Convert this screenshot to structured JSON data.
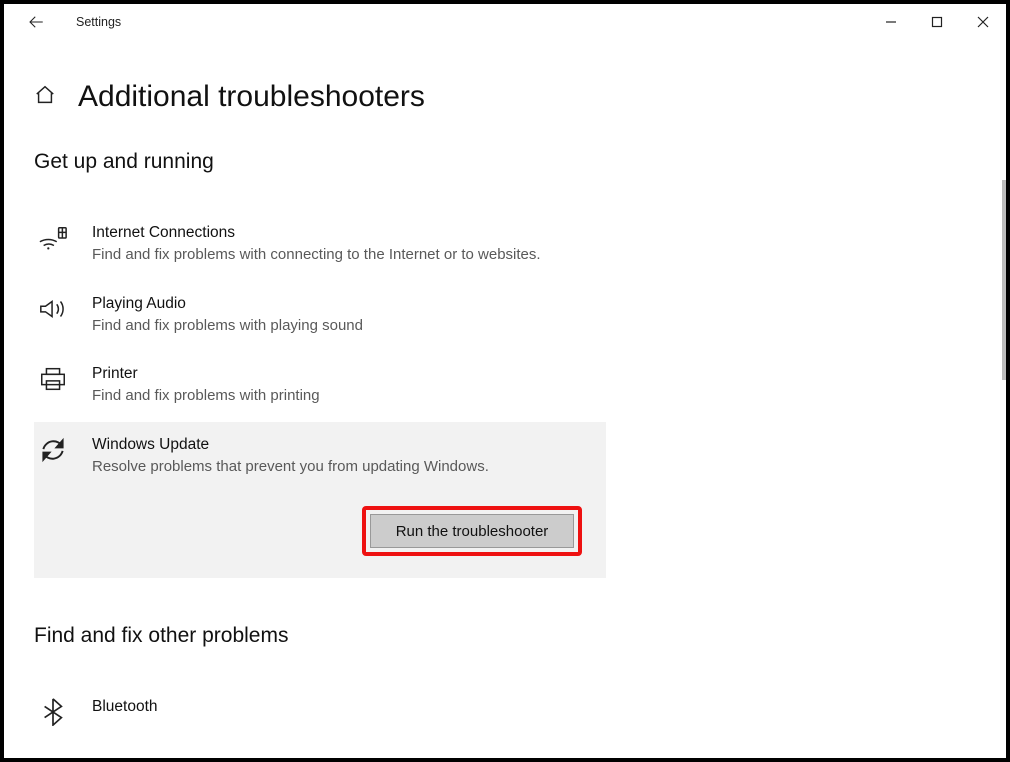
{
  "window": {
    "app_title": "Settings"
  },
  "page": {
    "title": "Additional troubleshooters"
  },
  "section1": {
    "title": "Get up and running",
    "items": [
      {
        "title": "Internet Connections",
        "desc": "Find and fix problems with connecting to the Internet or to websites."
      },
      {
        "title": "Playing Audio",
        "desc": "Find and fix problems with playing sound"
      },
      {
        "title": "Printer",
        "desc": "Find and fix problems with printing"
      },
      {
        "title": "Windows Update",
        "desc": "Resolve problems that prevent you from updating Windows."
      }
    ],
    "run_button": "Run the troubleshooter"
  },
  "section2": {
    "title": "Find and fix other problems",
    "items": [
      {
        "title": "Bluetooth"
      }
    ]
  }
}
